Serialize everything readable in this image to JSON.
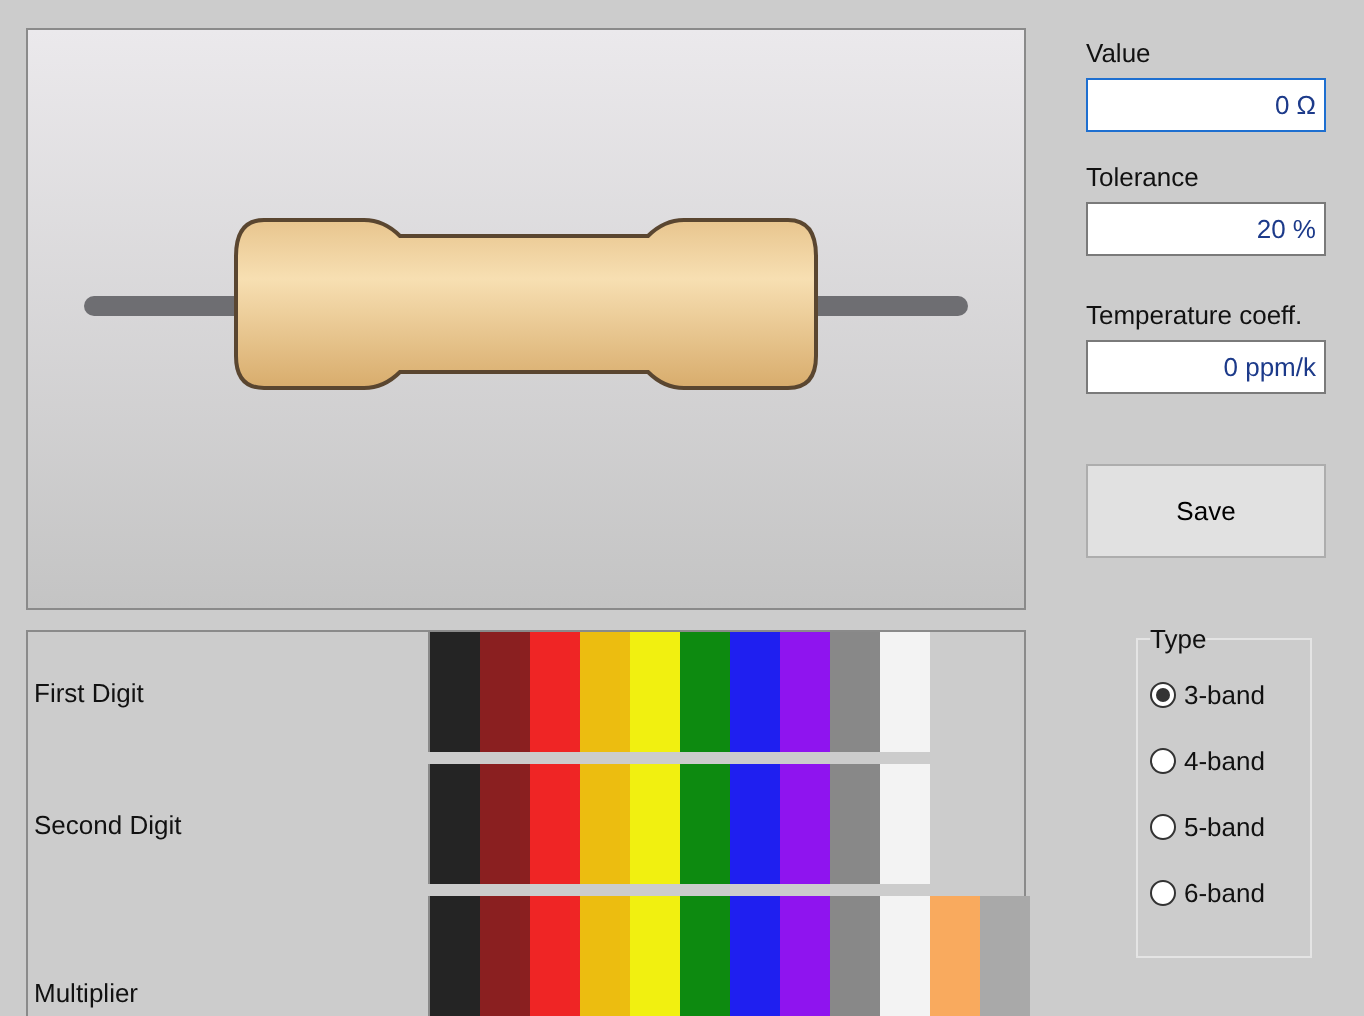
{
  "fields": [
    {
      "label": "Value",
      "value": "0 Ω",
      "focused": true
    },
    {
      "label": "Tolerance",
      "value": "20 %",
      "focused": false
    },
    {
      "label": "Temperature coeff.",
      "value": "0 ppm/k",
      "focused": false
    }
  ],
  "save_button": "Save",
  "type_group": {
    "title": "Type",
    "options": [
      {
        "label": "3-band",
        "selected": true
      },
      {
        "label": "4-band",
        "selected": false
      },
      {
        "label": "5-band",
        "selected": false
      },
      {
        "label": "6-band",
        "selected": false
      }
    ]
  },
  "band_rows": [
    {
      "label": "First Digit",
      "swatches": [
        {
          "color": "#242424"
        },
        {
          "color": "#8a1f20"
        },
        {
          "color": "#ef2525"
        },
        {
          "color": "#ecbd10"
        },
        {
          "color": "#f1f010"
        },
        {
          "color": "#0d8a10"
        },
        {
          "color": "#1f1ff0"
        },
        {
          "color": "#8f14ef"
        },
        {
          "color": "#888888"
        },
        {
          "color": "#f3f3f3"
        }
      ]
    },
    {
      "label": "Second Digit",
      "swatches": [
        {
          "color": "#242424"
        },
        {
          "color": "#8a1f20"
        },
        {
          "color": "#ef2525"
        },
        {
          "color": "#ecbd10"
        },
        {
          "color": "#f1f010"
        },
        {
          "color": "#0d8a10"
        },
        {
          "color": "#1f1ff0"
        },
        {
          "color": "#8f14ef"
        },
        {
          "color": "#888888"
        },
        {
          "color": "#f3f3f3"
        }
      ]
    },
    {
      "label": "Multiplier",
      "swatches": [
        {
          "color": "#242424"
        },
        {
          "color": "#8a1f20"
        },
        {
          "color": "#ef2525"
        },
        {
          "color": "#ecbd10"
        },
        {
          "color": "#f1f010"
        },
        {
          "color": "#0d8a10"
        },
        {
          "color": "#1f1ff0"
        },
        {
          "color": "#8f14ef"
        },
        {
          "color": "#888888"
        },
        {
          "color": "#f3f3f3"
        },
        {
          "color": "#f9aa5e"
        },
        {
          "color": "#a9a9a9"
        }
      ]
    }
  ]
}
